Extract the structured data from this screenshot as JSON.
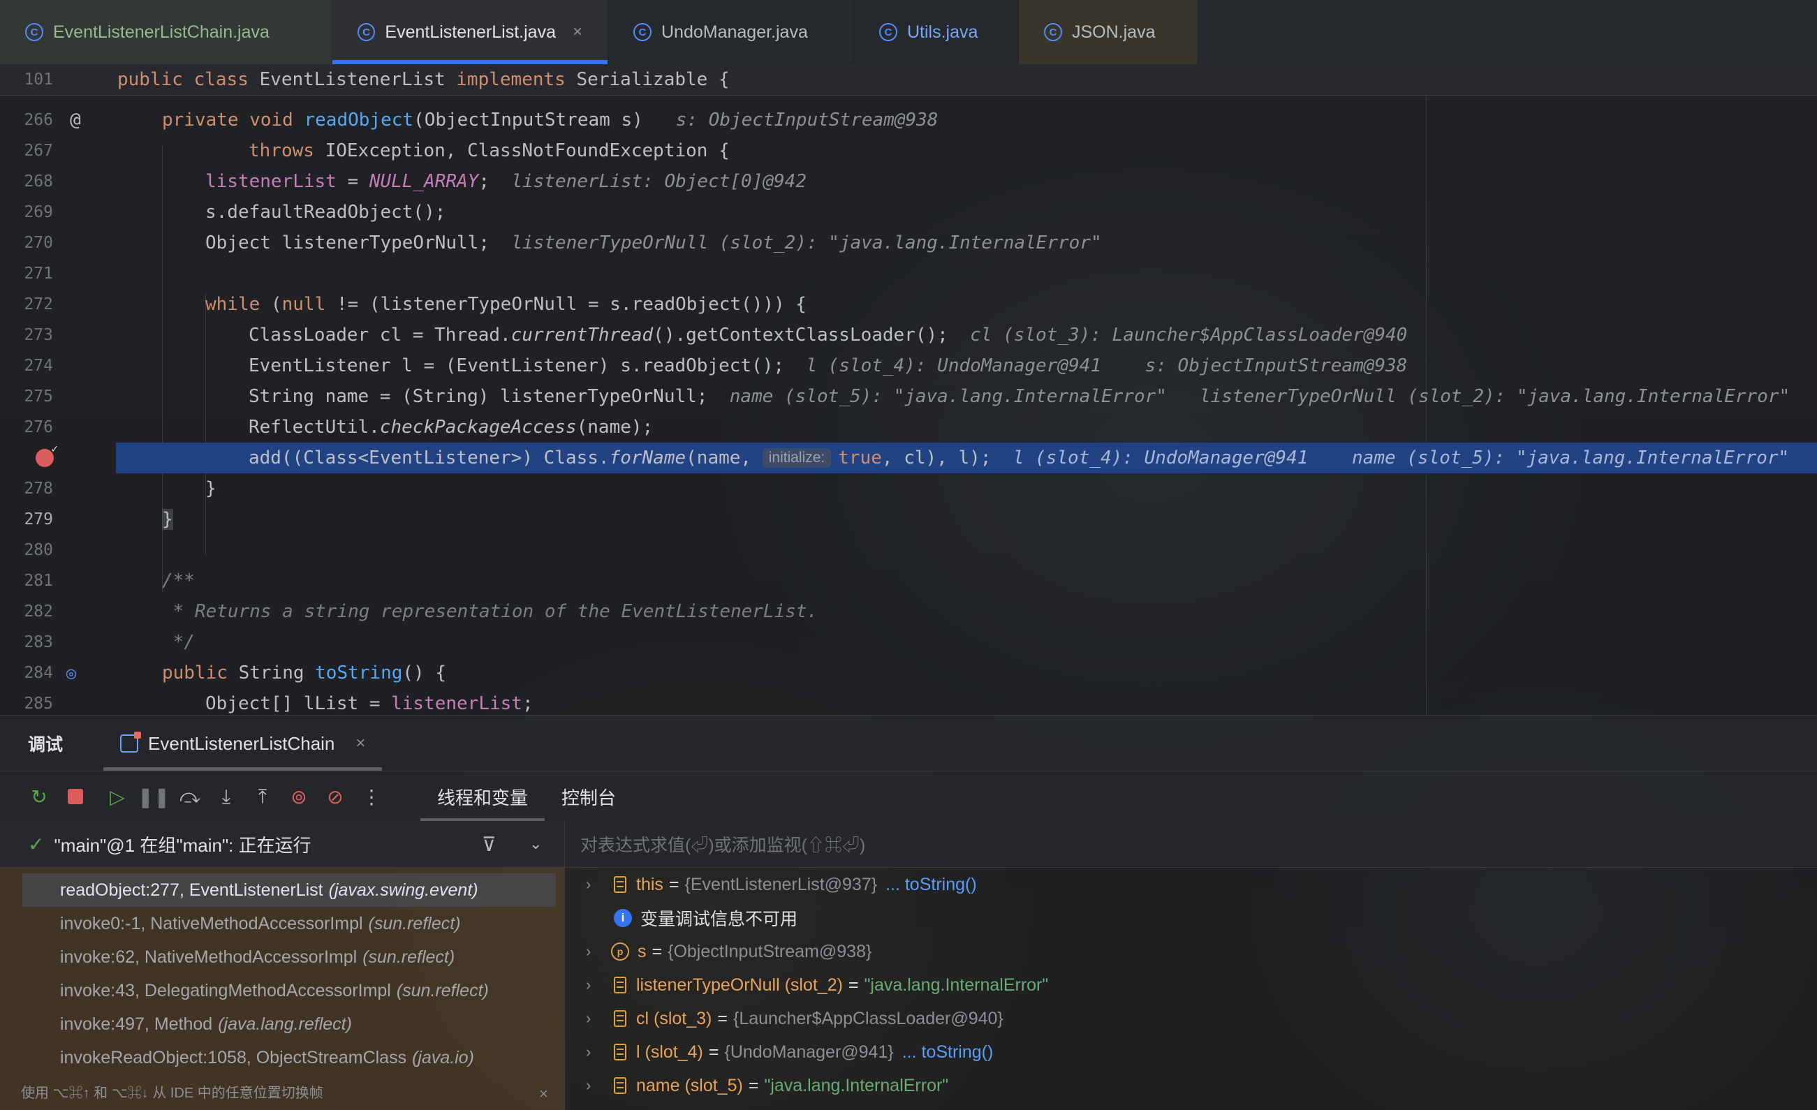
{
  "tabs": [
    {
      "label": "EventListenerListChain.java",
      "icon": "class-icon"
    },
    {
      "label": "EventListenerList.java",
      "icon": "class-icon",
      "active": true,
      "close": "×"
    },
    {
      "label": "UndoManager.java",
      "icon": "class-icon"
    },
    {
      "label": "Utils.java",
      "icon": "class-icon"
    },
    {
      "label": "JSON.java",
      "icon": "class-icon"
    }
  ],
  "editor": {
    "sticky": {
      "line": "101",
      "kw1": "public",
      "kw2": "class",
      "name": " EventListenerList ",
      "kw3": "implements",
      "rest": " Serializable {"
    },
    "lines": [
      {
        "n": "266"
      },
      {
        "n": "267"
      },
      {
        "n": "268"
      },
      {
        "n": "269"
      },
      {
        "n": "270"
      },
      {
        "n": "271"
      },
      {
        "n": "272"
      },
      {
        "n": "273"
      },
      {
        "n": "274"
      },
      {
        "n": "275"
      },
      {
        "n": "276"
      },
      {
        "n": "277"
      },
      {
        "n": "278"
      },
      {
        "n": "279"
      },
      {
        "n": "280"
      },
      {
        "n": "281"
      },
      {
        "n": "282"
      },
      {
        "n": "283"
      },
      {
        "n": "284"
      },
      {
        "n": "285"
      }
    ],
    "code": {
      "l266_kw": "private void ",
      "l266_fn": "readObject",
      "l266_rest": "(ObjectInputStream s)",
      "l266_hint": "s: ObjectInputStream@938",
      "l267_kw": "throws",
      "l267_rest": " IOException, ClassNotFoundException {",
      "l268_fld": "listenerList",
      "l268_eq": " = ",
      "l268_const": "NULL_ARRAY",
      "l268_semi": ";",
      "l268_hint": "listenerList: Object[0]@942",
      "l269": "s.defaultReadObject();",
      "l270": "Object listenerTypeOrNull;",
      "l270_hint": "listenerTypeOrNull (slot_2): \"java.lang.InternalError\"",
      "l272_kw": "while",
      "l272_a": " (",
      "l272_null": "null",
      "l272_rest": " != (listenerTypeOrNull = s.readObject())) {",
      "l273_a": "ClassLoader cl = Thread.",
      "l273_it": "currentThread",
      "l273_b": "().getContextClassLoader();",
      "l273_hint": "cl (slot_3): Launcher$AppClassLoader@940",
      "l274": "EventListener l = (EventListener) s.readObject();",
      "l274_hint1": "l (slot_4): UndoManager@941",
      "l274_hint2": "s: ObjectInputStream@938",
      "l275": "String name = (String) listenerTypeOrNull;",
      "l275_hint1": "name (slot_5): \"java.lang.InternalError\"",
      "l275_hint2": "listenerTypeOrNull (slot_2): \"java.lang.InternalError\"",
      "l276_a": "ReflectUtil.",
      "l276_it": "checkPackageAccess",
      "l276_b": "(name);",
      "l277_a": "add((Class<EventListener>) Class.",
      "l277_it": "forName",
      "l277_b": "(name, ",
      "l277_inlay": "initialize:",
      "l277_true": "true",
      "l277_c": ", cl), l);",
      "l277_hint1": "l (slot_4): UndoManager@941",
      "l277_hint2": "name (slot_5): \"java.lang.InternalError\"",
      "l278": "}",
      "l279": "}",
      "l281": "/**",
      "l282": " * Returns a string representation of the EventListenerList.",
      "l283": " */",
      "l284_kw": "public",
      "l284_rest": " String ",
      "l284_fn": "toString",
      "l284_end": "() {",
      "l285_a": "Object[] lList = ",
      "l285_fld": "listenerList",
      "l285_end": ";"
    }
  },
  "debug": {
    "title": "调试",
    "session": "EventListenerListChain",
    "session_close": "×",
    "subtabs": [
      "线程和变量",
      "控制台"
    ],
    "thread": "\"main\"@1 在组\"main\": 正在运行",
    "frames": [
      {
        "method": "readObject:277, EventListenerList",
        "pkg": "(javax.swing.event)"
      },
      {
        "method": "invoke0:-1, NativeMethodAccessorImpl",
        "pkg": "(sun.reflect)"
      },
      {
        "method": "invoke:62, NativeMethodAccessorImpl",
        "pkg": "(sun.reflect)"
      },
      {
        "method": "invoke:43, DelegatingMethodAccessorImpl",
        "pkg": "(sun.reflect)"
      },
      {
        "method": "invoke:497, Method",
        "pkg": "(java.lang.reflect)"
      },
      {
        "method": "invokeReadObject:1058, ObjectStreamClass",
        "pkg": "(java.io)"
      }
    ],
    "frames_hint": "使用 ⌥⌘↑ 和 ⌥⌘↓ 从 IDE 中的任意位置切换帧",
    "frames_hint_close": "×",
    "eval_placeholder": "对表达式求值(⏎)或添加监视(⇧⌘⏎)",
    "vars": {
      "this_name": "this",
      "this_val": "{EventListenerList@937}",
      "this_link": "... toString()",
      "info": "变量调试信息不可用",
      "s_name": "s",
      "s_val": "{ObjectInputStream@938}",
      "ltn_name": "listenerTypeOrNull (slot_2)",
      "ltn_val": "\"java.lang.InternalError\"",
      "cl_name": "cl (slot_3)",
      "cl_val": "{Launcher$AppClassLoader@940}",
      "l_name": "l (slot_4)",
      "l_val": "{UndoManager@941}",
      "l_link": "... toString()",
      "name_name": "name (slot_5)",
      "name_val": "\"java.lang.InternalError\"",
      "eq": "="
    }
  },
  "colors": {
    "accent": "#3574f0",
    "current_line": "#214283",
    "breakpoint": "#db5c5c",
    "keyword": "#cf8e6d",
    "function": "#56a8f5",
    "field": "#c77dbb",
    "string": "#6aab73"
  }
}
